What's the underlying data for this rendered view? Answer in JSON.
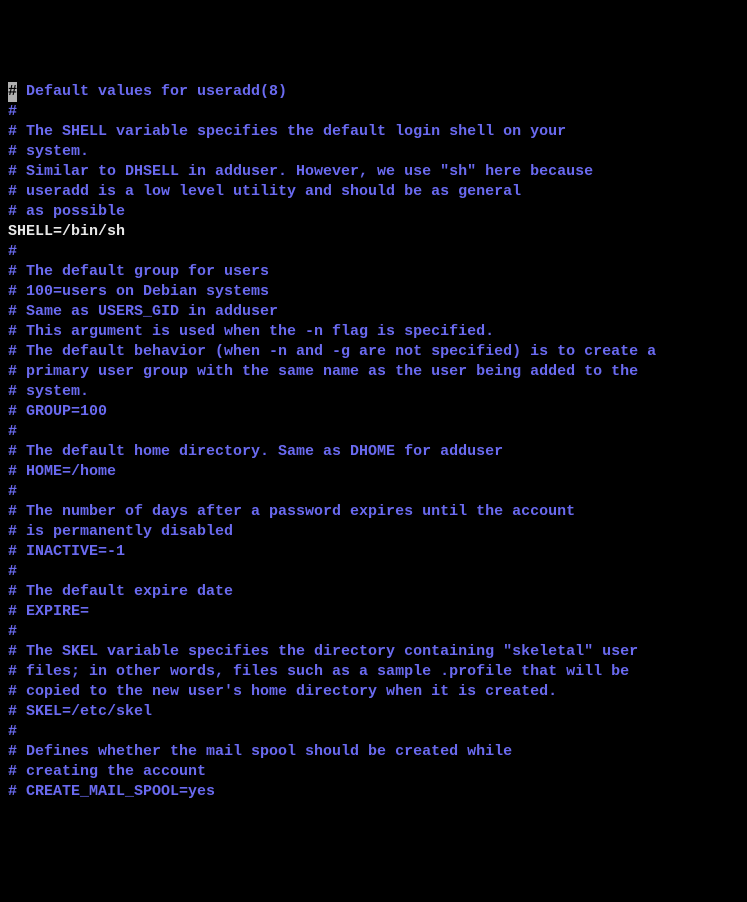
{
  "cursor_char": "#",
  "lines": [
    {
      "style": "comment",
      "text": " Default values for useradd(8)",
      "cursor": true
    },
    {
      "style": "comment",
      "text": "#"
    },
    {
      "style": "comment",
      "text": "# The SHELL variable specifies the default login shell on your"
    },
    {
      "style": "comment",
      "text": "# system."
    },
    {
      "style": "comment",
      "text": "# Similar to DHSELL in adduser. However, we use \"sh\" here because"
    },
    {
      "style": "comment",
      "text": "# useradd is a low level utility and should be as general"
    },
    {
      "style": "comment",
      "text": "# as possible"
    },
    {
      "style": "active",
      "text": "SHELL=/bin/sh"
    },
    {
      "style": "comment",
      "text": "#"
    },
    {
      "style": "comment",
      "text": "# The default group for users"
    },
    {
      "style": "comment",
      "text": "# 100=users on Debian systems"
    },
    {
      "style": "comment",
      "text": "# Same as USERS_GID in adduser"
    },
    {
      "style": "comment",
      "text": "# This argument is used when the -n flag is specified."
    },
    {
      "style": "comment",
      "text": "# The default behavior (when -n and -g are not specified) is to create a"
    },
    {
      "style": "comment",
      "text": "# primary user group with the same name as the user being added to the"
    },
    {
      "style": "comment",
      "text": "# system."
    },
    {
      "style": "comment",
      "text": "# GROUP=100"
    },
    {
      "style": "comment",
      "text": "#"
    },
    {
      "style": "comment",
      "text": "# The default home directory. Same as DHOME for adduser"
    },
    {
      "style": "comment",
      "text": "# HOME=/home"
    },
    {
      "style": "comment",
      "text": "#"
    },
    {
      "style": "comment",
      "text": "# The number of days after a password expires until the account"
    },
    {
      "style": "comment",
      "text": "# is permanently disabled"
    },
    {
      "style": "comment",
      "text": "# INACTIVE=-1"
    },
    {
      "style": "comment",
      "text": "#"
    },
    {
      "style": "comment",
      "text": "# The default expire date"
    },
    {
      "style": "comment",
      "text": "# EXPIRE="
    },
    {
      "style": "comment",
      "text": "#"
    },
    {
      "style": "comment",
      "text": "# The SKEL variable specifies the directory containing \"skeletal\" user"
    },
    {
      "style": "comment",
      "text": "# files; in other words, files such as a sample .profile that will be"
    },
    {
      "style": "comment",
      "text": "# copied to the new user's home directory when it is created."
    },
    {
      "style": "comment",
      "text": "# SKEL=/etc/skel"
    },
    {
      "style": "comment",
      "text": "#"
    },
    {
      "style": "comment",
      "text": "# Defines whether the mail spool should be created while"
    },
    {
      "style": "comment",
      "text": "# creating the account"
    },
    {
      "style": "comment",
      "text": "# CREATE_MAIL_SPOOL=yes"
    }
  ]
}
